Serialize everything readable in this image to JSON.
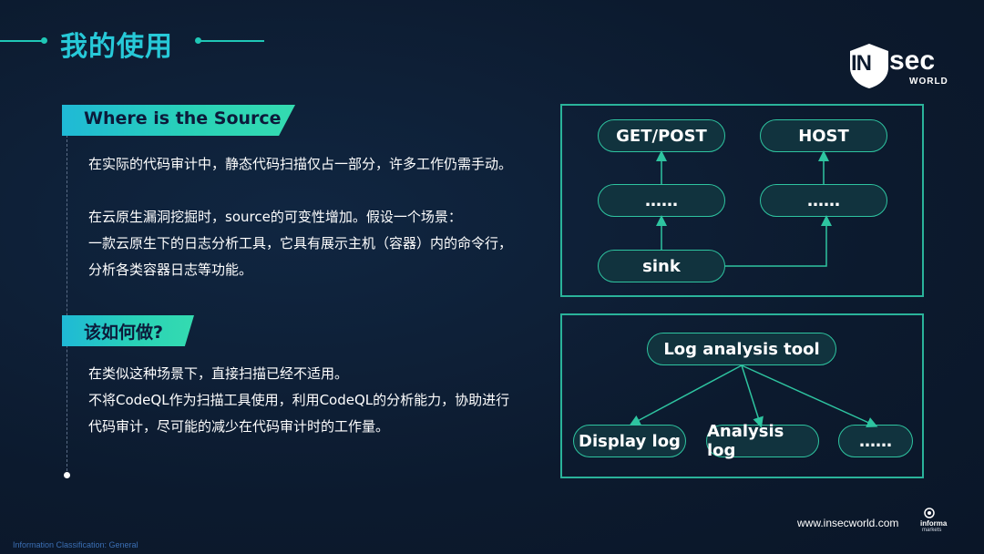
{
  "title": "我的使用",
  "logo": {
    "in": "IN",
    "sec": "sec",
    "world": "WORLD"
  },
  "sections": [
    {
      "heading": "Where is the Source",
      "lines": [
        "在实际的代码审计中，静态代码扫描仅占一部分，许多工作仍需手动。",
        "",
        "在云原生漏洞挖掘时，source的可变性增加。假设一个场景：",
        "一款云原生下的日志分析工具，它具有展示主机（容器）内的命令行，",
        "分析各类容器日志等功能。"
      ]
    },
    {
      "heading": "该如何做?",
      "lines": [
        "在类似这种场景下，直接扫描已经不适用。",
        "不将CodeQL作为扫描工具使用，利用CodeQL的分析能力，协助进行",
        "代码审计，尽可能的减少在代码审计时的工作量。"
      ]
    }
  ],
  "diagram1": {
    "nodes": {
      "get_post": "GET/POST",
      "host": "HOST",
      "mid_left": "……",
      "mid_right": "……",
      "sink": "sink"
    }
  },
  "diagram2": {
    "nodes": {
      "root": "Log analysis tool",
      "display": "Display log",
      "analysis": "Analysis log",
      "more": "……"
    }
  },
  "footer": {
    "url": "www.insecworld.com",
    "informa": "informa",
    "informa_sub": "markets",
    "classification": "Information Classification: General"
  },
  "colors": {
    "accent": "#27c9d8",
    "diagram_border": "#2ab39a",
    "background": "#0c1a2e"
  },
  "icons": [
    "shield-logo-icon",
    "informa-logo-icon"
  ]
}
